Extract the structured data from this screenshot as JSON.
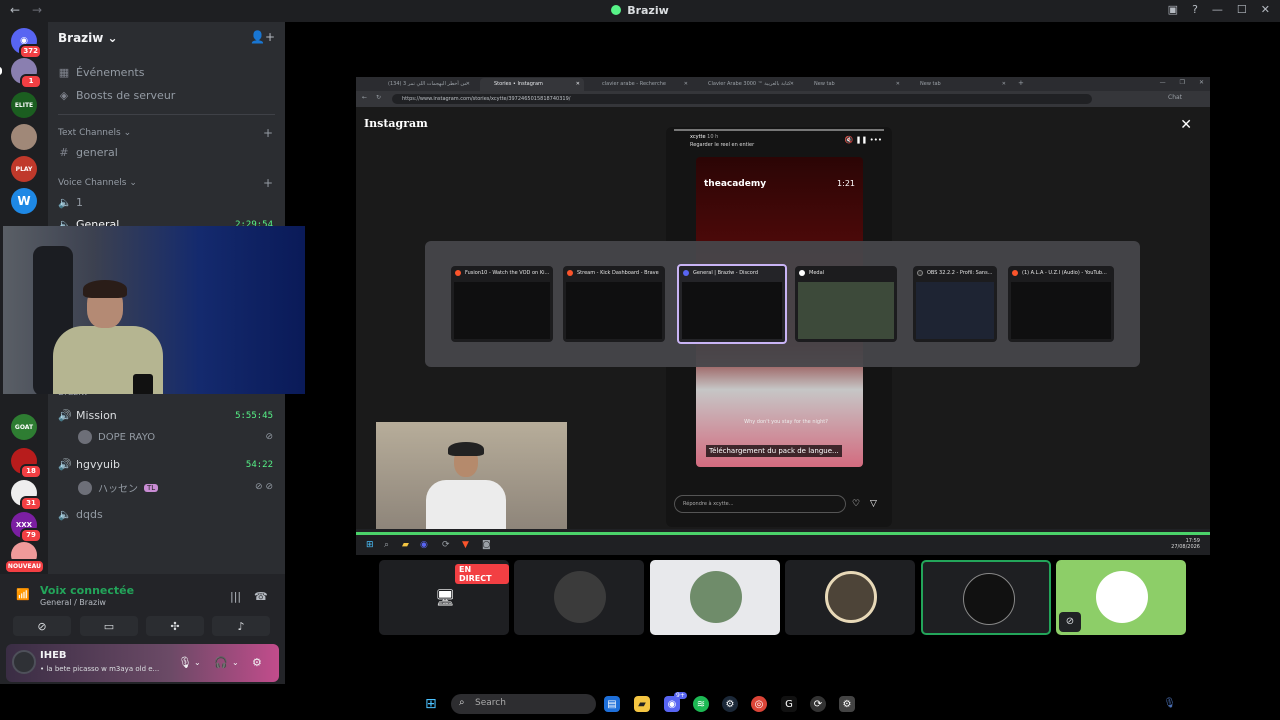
{
  "titlebar": {
    "title": "Braziw",
    "back": "←",
    "forward": "→",
    "icons": [
      "inbox-icon",
      "help-icon",
      "minimize",
      "maximize",
      "close"
    ]
  },
  "rail": {
    "servers": [
      {
        "name": "discord-home",
        "badge": "372",
        "color": "#5865f2",
        "glyph": "◉"
      },
      {
        "name": "server-anime",
        "badge": "1",
        "color": "#8a7fb0",
        "glyph": ""
      },
      {
        "name": "server-elite",
        "badge": "",
        "color": "#1b5e20",
        "glyph": "ELITE"
      },
      {
        "name": "server-portrait",
        "badge": "",
        "color": "#a08878",
        "glyph": ""
      },
      {
        "name": "server-play",
        "badge": "",
        "color": "#c0392b",
        "glyph": "PLAY"
      },
      {
        "name": "server-w",
        "badge": "",
        "color": "#1e88e5",
        "glyph": "W"
      },
      {
        "name": "server-goat",
        "badge": "",
        "color": "#2e7d32",
        "glyph": "GOAT"
      },
      {
        "name": "server-red",
        "badge": "18",
        "color": "#b71c1c",
        "glyph": ""
      },
      {
        "name": "server-bw",
        "badge": "31",
        "color": "#eeeeee",
        "glyph": ""
      },
      {
        "name": "server-xxx",
        "badge": "79",
        "color": "#7b1fa2",
        "glyph": "XXX"
      },
      {
        "name": "server-new",
        "badge": "NOUVEAU",
        "color": "#ef9a9a",
        "glyph": ""
      }
    ]
  },
  "channels": {
    "server_name": "Braziw",
    "events": "Événements",
    "boosts": "Boosts de serveur",
    "text_category": "Text Channels",
    "text_channels": [
      "general"
    ],
    "voice_category": "Voice Channels",
    "voice_channels": [
      {
        "name": "1"
      },
      {
        "name": "General",
        "time": "2:29:54"
      },
      {
        "name": "Mission",
        "time": "5:55:45",
        "user": "DOPE RAYO"
      },
      {
        "name": "hgvyuib",
        "time": "54:22",
        "user": "ハッセン",
        "tag": "TL"
      },
      {
        "name": "dqds"
      }
    ],
    "partial_user": "Braziw"
  },
  "voice_panel": {
    "title": "Voix connectée",
    "subtitle": "General / Braziw"
  },
  "user_bar": {
    "name": "IHEB",
    "status": "• la bete picasso w m3aya old e..."
  },
  "browser": {
    "tabs": [
      {
        "label": "(134) 3 من أخطر البهجمات اللي تمر",
        "active": false
      },
      {
        "label": "Stories • Instagram",
        "active": true
      },
      {
        "label": "clavier arabe - Recherche",
        "active": false
      },
      {
        "label": "Clavier Arabe 3000 ™ كتابة بالعربية",
        "active": false
      },
      {
        "label": "New tab",
        "active": false
      },
      {
        "label": "New tab",
        "active": false
      }
    ],
    "url": "https://www.instagram.com/stories/xcytte/3972465015818740319/",
    "chat_label": "Chat"
  },
  "instagram": {
    "logo": "Instagram",
    "story_user": "xcytte",
    "story_age": "10 h",
    "story_sub": "Regarder le reel en entier",
    "video_title": "theacademy",
    "video_time": "1:21",
    "lyrics": "Why don't you stay for the night?",
    "caption": "Téléchargement du pack de langue...",
    "reply_placeholder": "Répondre à xcytte..."
  },
  "switcher": {
    "items": [
      {
        "label": "Fusion10 - Watch the VOD on Ki...",
        "selected": false,
        "dot": "#fb542b"
      },
      {
        "label": "Stream - Kick Dashboard - Brave",
        "selected": false,
        "dot": "#fb542b"
      },
      {
        "label": "General | Braziw - Discord",
        "selected": true,
        "dot": "#5865f2"
      },
      {
        "label": "Medal",
        "selected": false,
        "dot": "#ffffff"
      },
      {
        "label": "OBS 32.2.2 - Profil: Sans...",
        "selected": false,
        "dot": "#333333"
      },
      {
        "label": "(1) A.L.A - U.Z.I (Audio) - YouTub...",
        "selected": false,
        "dot": "#fb542b"
      }
    ]
  },
  "inner_taskbar": {
    "time": "17:59",
    "date": "27/08/2026"
  },
  "tiles": [
    {
      "name": "tile-stream",
      "live": "EN DIRECT"
    },
    {
      "name": "tile-user-2"
    },
    {
      "name": "tile-user-3"
    },
    {
      "name": "tile-user-4"
    },
    {
      "name": "tile-user-5"
    },
    {
      "name": "tile-user-6"
    }
  ],
  "taskbar": {
    "search_placeholder": "Search",
    "notif": "9+"
  }
}
